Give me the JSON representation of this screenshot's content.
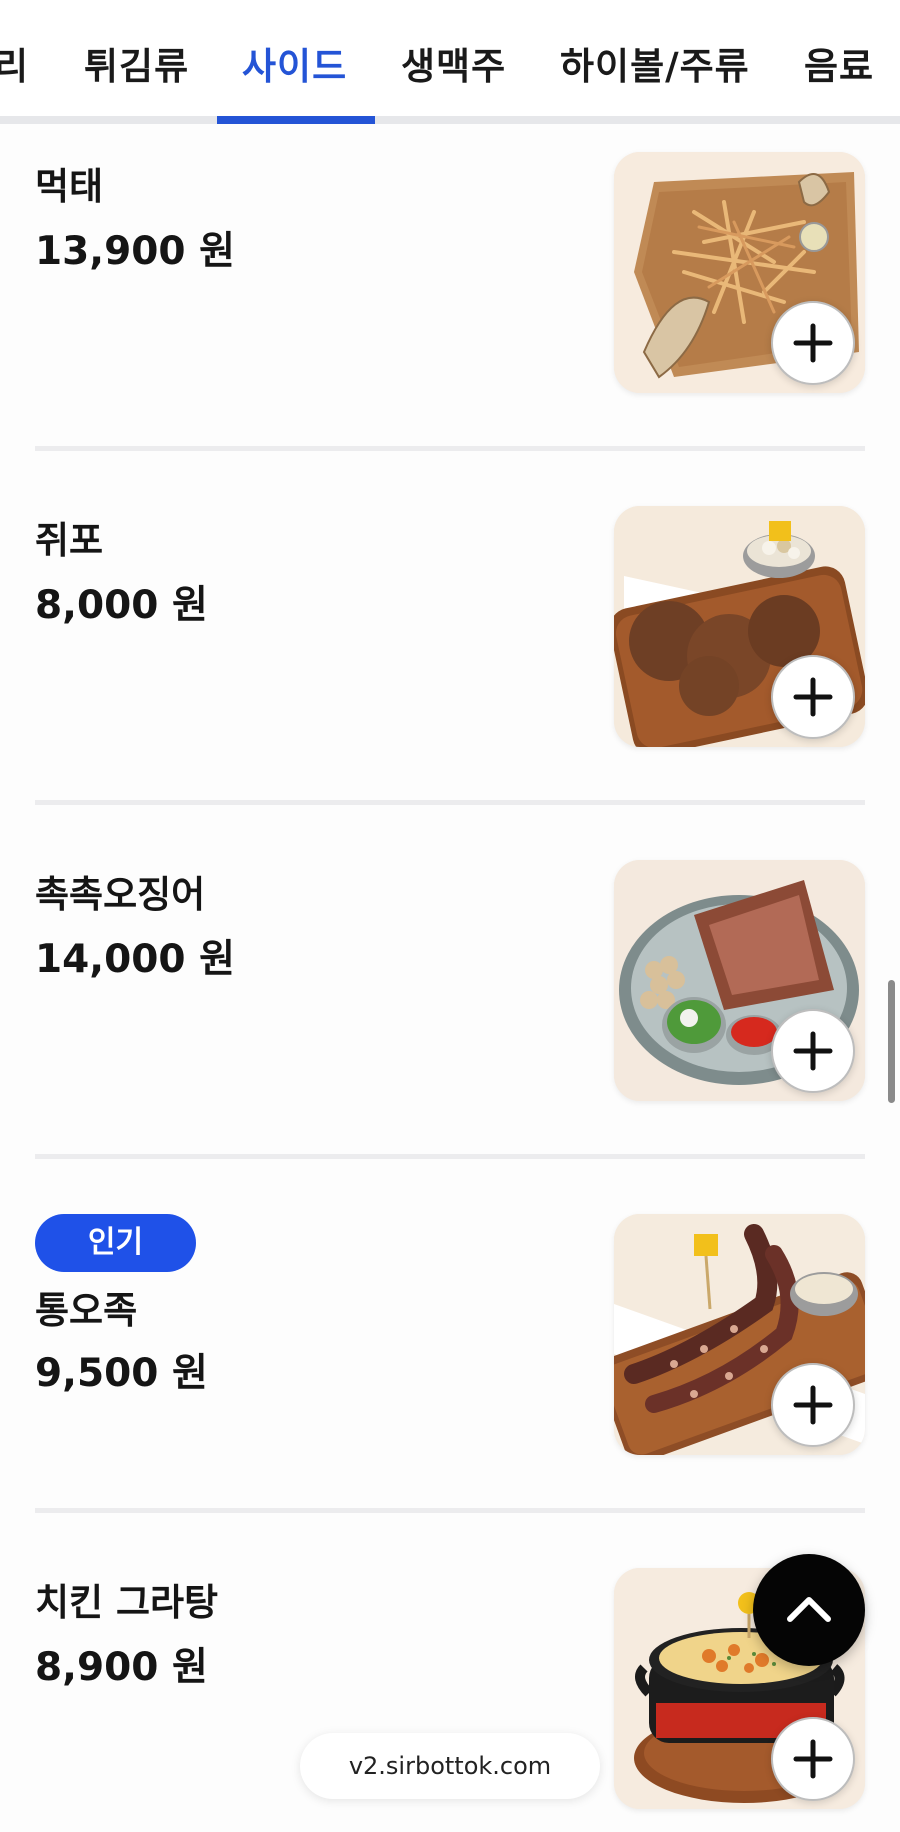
{
  "tabs": [
    {
      "label": "리",
      "active": false
    },
    {
      "label": "튀김류",
      "active": false
    },
    {
      "label": "사이드",
      "active": true
    },
    {
      "label": "생맥주",
      "active": false
    },
    {
      "label": "하이볼/주류",
      "active": false
    },
    {
      "label": "음료",
      "active": false
    }
  ],
  "accent_color": "#2454d6",
  "badge_color": "#1f51e8",
  "items": [
    {
      "name": "먹태",
      "price": "13,900 원",
      "badge": ""
    },
    {
      "name": "쥐포",
      "price": "8,000 원",
      "badge": ""
    },
    {
      "name": "촉촉오징어",
      "price": "14,000 원",
      "badge": ""
    },
    {
      "name": "통오족",
      "price": "9,500 원",
      "badge": "인기"
    },
    {
      "name": "치킨 그라탕",
      "price": "8,900 원",
      "badge": ""
    }
  ],
  "icons": {
    "add": "plus-icon",
    "scroll_top": "chevron-up-icon"
  },
  "browser": {
    "url": "v2.sirbottok.com"
  }
}
